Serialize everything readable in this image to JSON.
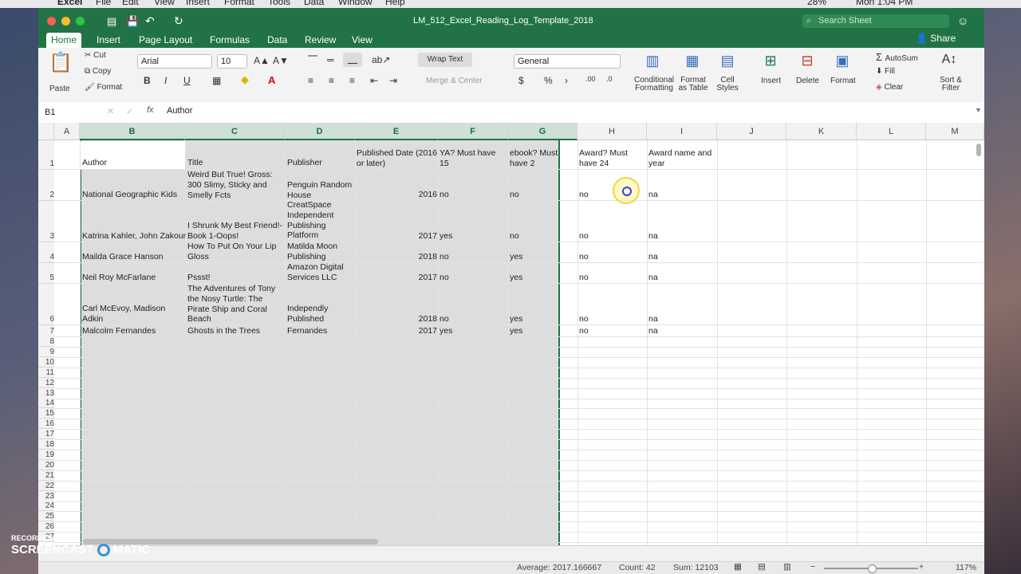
{
  "menubar": {
    "app": "Excel",
    "items": [
      "File",
      "Edit",
      "View",
      "Insert",
      "Format",
      "Tools",
      "Data",
      "Window",
      "Help"
    ],
    "battery": "28%",
    "clock": "Mon 1:04 PM"
  },
  "window": {
    "filename": "LM_512_Excel_Reading_Log_Template_2018",
    "search_placeholder": "Search Sheet",
    "share_label": "Share"
  },
  "tabs": [
    "Home",
    "Insert",
    "Page Layout",
    "Formulas",
    "Data",
    "Review",
    "View"
  ],
  "ribbon": {
    "paste": "Paste",
    "cut": "Cut",
    "copy": "Copy",
    "format_painter": "Format",
    "font_name": "Arial",
    "font_size": "10",
    "bold": "B",
    "italic": "I",
    "underline": "U",
    "wrap_text": "Wrap Text",
    "merge_center": "Merge & Center",
    "number_format": "General",
    "currency": "$",
    "percent": "%",
    "conditional_formatting": "Conditional\nFormatting",
    "format_as_table": "Format\nas Table",
    "cell_styles": "Cell\nStyles",
    "insert": "Insert",
    "delete": "Delete",
    "format": "Format",
    "autosum": "AutoSum",
    "fill": "Fill",
    "clear": "Clear",
    "sort_filter": "Sort &\nFilter"
  },
  "formula_bar": {
    "name_box": "B1",
    "fx": "fx",
    "value": "Author"
  },
  "columns": [
    "A",
    "B",
    "C",
    "D",
    "E",
    "F",
    "G",
    "H",
    "I",
    "J",
    "K",
    "L",
    "M"
  ],
  "rows": [
    {
      "n": "1",
      "B": "Author",
      "C": "Title",
      "D": "Publisher",
      "E": "Published Date (2016 or later)",
      "F": "YA? Must have 15",
      "G": "ebook? Must have 2",
      "H": "Award? Must have 24",
      "I": "Award name and year"
    },
    {
      "n": "2",
      "B": "National Geographic Kids",
      "C": "Weird But True! Gross: 300 Slimy, Sticky and Smelly Fcts",
      "D": "Penguin Random House",
      "E": "2016",
      "F": "no",
      "G": "no",
      "H": "no",
      "I": "na"
    },
    {
      "n": "3",
      "B": "Katrina Kahler, John Zakour",
      "C": "I Shrunk My Best Friend!- Book 1-Oops!",
      "D": "CreatSpace Independent Publishing Platform",
      "E": "2017",
      "F": "yes",
      "G": "no",
      "H": "no",
      "I": "na"
    },
    {
      "n": "4",
      "B": "Mailda Grace Hanson",
      "C": "How To Put On Your Lip Gloss",
      "D": "Matilda Moon Publishing",
      "E": "2018",
      "F": "no",
      "G": "yes",
      "H": "no",
      "I": "na"
    },
    {
      "n": "5",
      "B": "Neil Roy McFarlane",
      "C": "Pssst!",
      "D": "Amazon Digital Services LLC",
      "E": "2017",
      "F": "no",
      "G": "yes",
      "H": "no",
      "I": "na"
    },
    {
      "n": "6",
      "B": "Carl McEvoy, Madison Adkin",
      "C": "The Adventures of Tony the Nosy Turtle: The Pirate Ship and Coral Beach",
      "D": "Independly Published",
      "E": "2018",
      "F": "no",
      "G": "yes",
      "H": "no",
      "I": "na"
    },
    {
      "n": "7",
      "B": "Malcolm Fernandes",
      "C": "Ghosts in the Trees",
      "D": "Fernandes",
      "E": "2017",
      "F": "yes",
      "G": "yes",
      "H": "no",
      "I": "na"
    }
  ],
  "empty_rows": [
    "8",
    "9",
    "10",
    "11",
    "12",
    "13",
    "14",
    "15",
    "16",
    "17",
    "18",
    "19",
    "20",
    "21",
    "22",
    "23",
    "24",
    "25",
    "26",
    "27"
  ],
  "status": {
    "average": "Average: 2017.166667",
    "count": "Count: 42",
    "sum": "Sum: 12103",
    "zoom": "117%"
  },
  "watermark": {
    "line1": "RECORDED WITH",
    "line2": "SCREENCAST",
    "line3": "MATIC"
  }
}
